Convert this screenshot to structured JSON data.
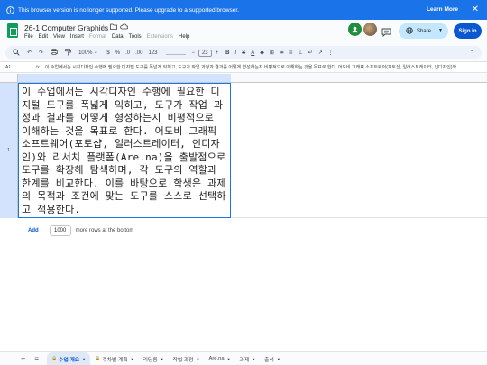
{
  "banner": {
    "message": "This browser version is no longer supported. Please upgrade to a supported browser.",
    "learn_more": "Learn More",
    "close": "✕",
    "bg": "#1a73e8"
  },
  "doc": {
    "title": "26-1 Computer Graphics",
    "menus": [
      "File",
      "Edit",
      "View",
      "Insert",
      "Format",
      "Data",
      "Tools",
      "Extensions",
      "Help"
    ]
  },
  "share": {
    "label": "Share",
    "bg": "#c2e7ff"
  },
  "signin": {
    "label": "Sign in",
    "bg": "#0b57d0"
  },
  "toolbar": {
    "zoom": "100%",
    "font_size": "23"
  },
  "formula": {
    "cell_ref": "A1",
    "fx": "fx",
    "value": "이 수업에서는 시각디자인 수행에 필요한 디지털 도구를 폭넓게 익히고, 도구가 작업 과정과 결과를 어떻게 형성하는지 비평적으로 이해하는 것을 목표로 한다. 어도비 그래픽 소프트웨어(포토샵, 일러스트레이터, 인디자인)와"
  },
  "grid": {
    "row_number": "1",
    "cell_text": "이 수업에서는 시각디자인 수행에 필요한 디지털 도구를 폭넓게 익히고, 도구가 작업 과정과 결과를 어떻게 형성하는지 비평적으로 이해하는 것을 목표로 한다. 어도비 그래픽 소프트웨어(포토샵, 일러스트레이터, 인디자인)와 리서치 플랫폼(Are.na)을 출발점으로 도구를 확장해 탐색하며, 각 도구의 역할과 한계를 비교한다. 이를 바탕으로 학생은 과제의 목적과 조건에 맞는 도구를 스스로 선택하고 적용한다."
  },
  "add_rows": {
    "button": "Add",
    "count": "1000",
    "suffix": "more rows at the bottom"
  },
  "sheets": {
    "add": "+",
    "menu": "≡",
    "tabs": [
      {
        "label": "수업 개요",
        "active": true,
        "locked": true
      },
      {
        "label": "주차별 계획",
        "active": false,
        "locked": true
      },
      {
        "label": "리딩룸",
        "active": false,
        "locked": false
      },
      {
        "label": "작업 과정",
        "active": false,
        "locked": false
      },
      {
        "label": "Are.na",
        "active": false,
        "locked": false
      },
      {
        "label": "과제",
        "active": false,
        "locked": false
      },
      {
        "label": "출석",
        "active": false,
        "locked": false
      }
    ]
  }
}
